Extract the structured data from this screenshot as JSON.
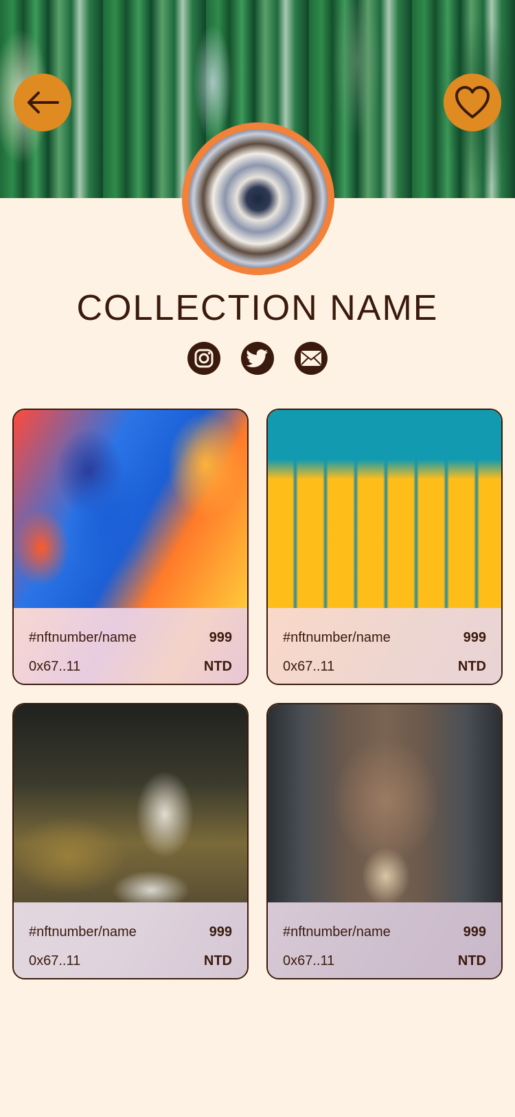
{
  "header": {
    "back_icon": "arrow-left-icon",
    "favorite_icon": "heart-icon",
    "accent_color": "#e08a22"
  },
  "collection": {
    "name": "COLLECTION NAME"
  },
  "socials": [
    {
      "icon": "instagram-icon"
    },
    {
      "icon": "twitter-icon"
    },
    {
      "icon": "mail-icon"
    }
  ],
  "cards": [
    {
      "name": "#nftnumber/name",
      "price": "999",
      "address": "0x67..11",
      "currency": "NTD"
    },
    {
      "name": "#nftnumber/name",
      "price": "999",
      "address": "0x67..11",
      "currency": "NTD"
    },
    {
      "name": "#nftnumber/name",
      "price": "999",
      "address": "0x67..11",
      "currency": "NTD"
    },
    {
      "name": "#nftnumber/name",
      "price": "999",
      "address": "0x67..11",
      "currency": "NTD"
    }
  ]
}
